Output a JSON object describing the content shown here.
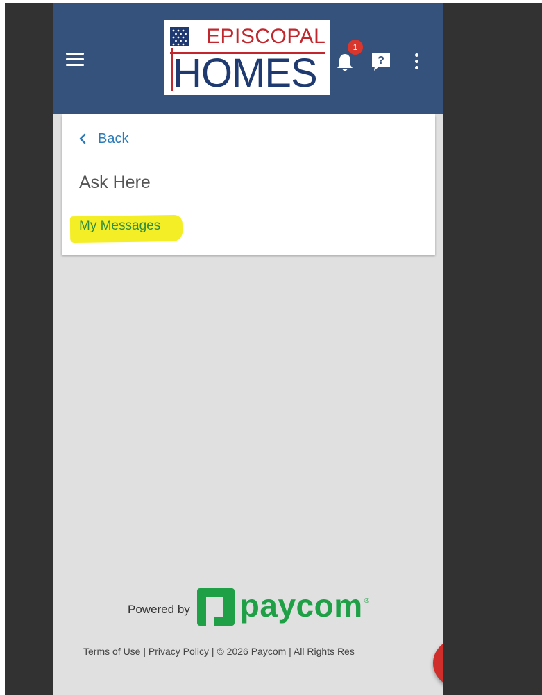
{
  "header": {
    "logo_line1": "EPISCOPAL",
    "logo_line2": "HOMES",
    "notification_count": "1",
    "icons": [
      "hamburger-menu-icon",
      "bell-icon",
      "help-icon",
      "more-vert-icon"
    ]
  },
  "card": {
    "back_label": "Back",
    "title": "Ask Here",
    "link_label": "My Messages"
  },
  "branding": {
    "powered_by": "Powered by",
    "wordmark": "paycom",
    "registered": "®"
  },
  "footer": {
    "terms": "Terms of Use",
    "separator": " | ",
    "privacy": "Privacy Policy",
    "copyright": "© 2026 Paycom",
    "rights": "All Rights Res"
  },
  "fab": {
    "icon": "clock-icon"
  },
  "colors": {
    "header_bg": "#34527c",
    "link_blue": "#2a7bb8",
    "highlight": "#f4ee26",
    "link_green": "#2f8d3f",
    "paycom_green": "#1fa047",
    "fab_red": "#d02e2a",
    "badge_red": "#d9362e"
  }
}
